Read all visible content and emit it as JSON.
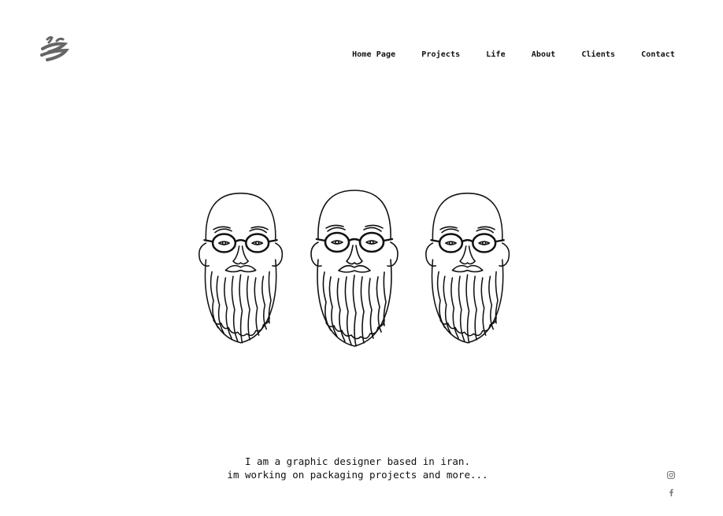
{
  "nav": {
    "items": [
      {
        "label": "Home Page"
      },
      {
        "label": "Projects"
      },
      {
        "label": "Life"
      },
      {
        "label": "About"
      },
      {
        "label": "Clients"
      },
      {
        "label": "Contact"
      }
    ]
  },
  "hero": {
    "illustration": "three-bearded-bald-man-portraits"
  },
  "intro": {
    "line1": "I am a graphic designer based in iran.",
    "line2": "im working on packaging projects and more..."
  },
  "social": {
    "icons": [
      "instagram-icon",
      "facebook-icon"
    ]
  },
  "colors": {
    "ink": "#111111",
    "muted": "#777777",
    "background": "#ffffff"
  }
}
